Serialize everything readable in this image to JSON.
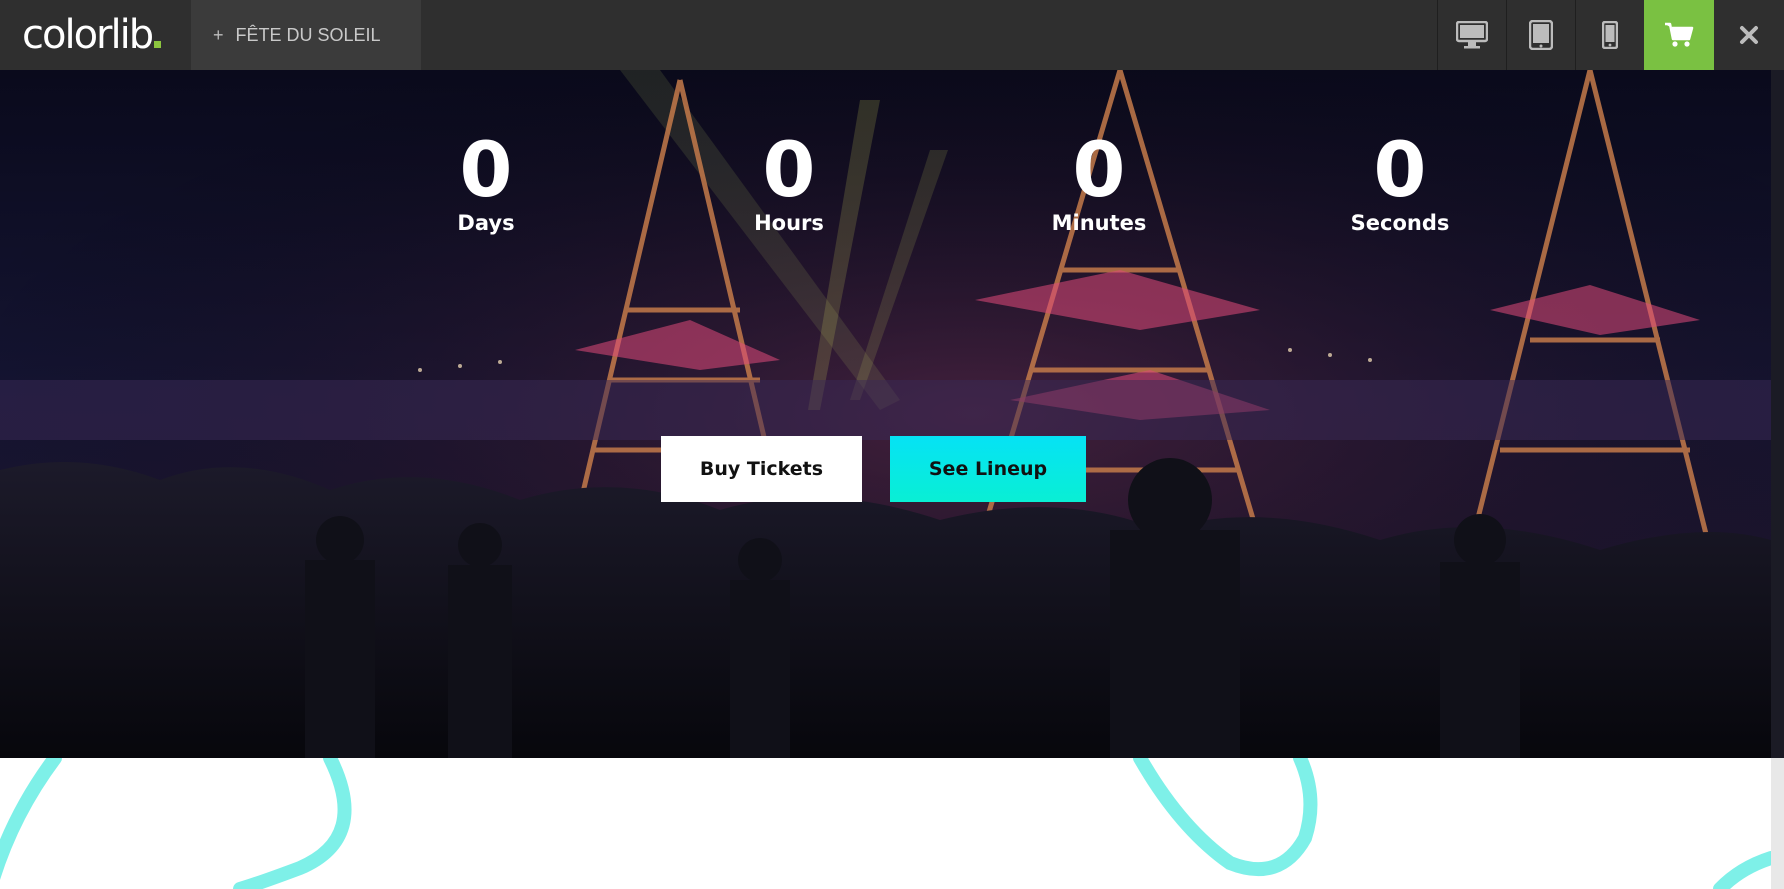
{
  "topbar": {
    "logo_text": "colorlib",
    "theme_name": "FÊTE DU SOLEIL",
    "plus_symbol": "+",
    "devices": [
      "desktop-icon",
      "tablet-icon",
      "mobile-icon",
      "cart-icon",
      "close-icon"
    ],
    "cart_color": "#7ac142"
  },
  "countdown": [
    {
      "value": "0",
      "label": "Days"
    },
    {
      "value": "0",
      "label": "Hours"
    },
    {
      "value": "0",
      "label": "Minutes"
    },
    {
      "value": "0",
      "label": "Seconds"
    }
  ],
  "buttons": {
    "buy_tickets": "Buy Tickets",
    "see_lineup": "See Lineup"
  },
  "colors": {
    "accent_cyan": "#06e2f5",
    "swirl": "#7ef0e8"
  }
}
